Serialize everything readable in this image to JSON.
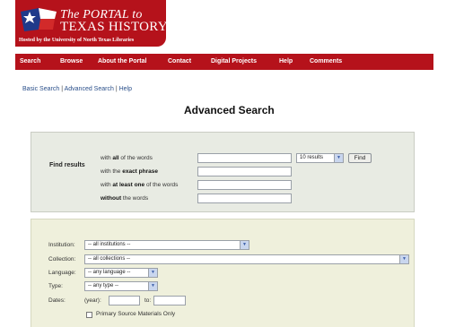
{
  "header": {
    "logo_top": "The PORTAL to",
    "logo_main": "TEXAS HISTORY",
    "logo_tm": "sm",
    "hosted_by": "Hosted by the University of North Texas Libraries"
  },
  "nav": {
    "items": [
      "Search",
      "Browse",
      "About the Portal",
      "Contact",
      "Digital Projects",
      "Help",
      "Comments"
    ]
  },
  "breadcrumb": {
    "basic": "Basic Search",
    "advanced": "Advanced Search",
    "help": "Help",
    "sep": "|"
  },
  "page_title": "Advanced Search",
  "find": {
    "label": "Find results",
    "rows": [
      {
        "pre": "with ",
        "bold": "all",
        "post": " of the words",
        "value": ""
      },
      {
        "pre": "with the ",
        "bold": "exact phrase",
        "post": "",
        "value": ""
      },
      {
        "pre": "with ",
        "bold": "at least one",
        "post": " of the words",
        "value": ""
      },
      {
        "pre": "",
        "bold": "without",
        "post": " the words",
        "value": ""
      }
    ],
    "results_select": "10 results",
    "find_button": "Find"
  },
  "filters": {
    "institution_label": "Institution:",
    "institution_value": "-- all institutions --",
    "collection_label": "Collection:",
    "collection_value": "-- all collections --",
    "language_label": "Language:",
    "language_value": "-- any language --",
    "type_label": "Type:",
    "type_value": "-- any type --",
    "dates_label": "Dates:",
    "year_label": "(year):",
    "to_label": "to:",
    "from_value": "",
    "to_value": "",
    "primary_label": "Primary Source Materials Only"
  }
}
